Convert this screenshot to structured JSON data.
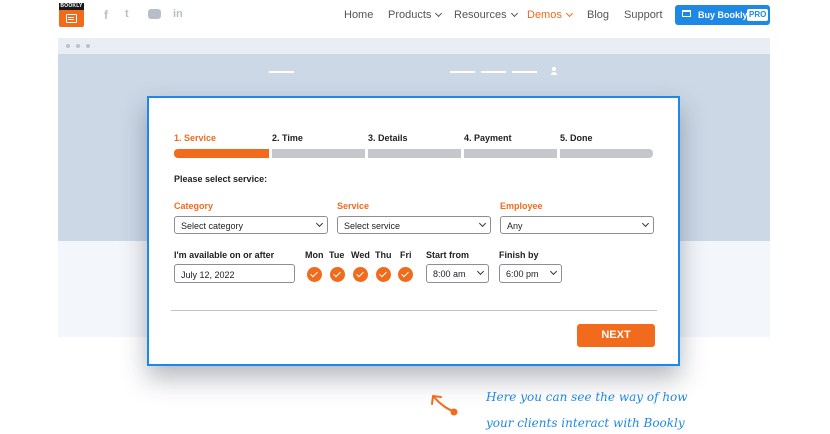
{
  "header": {
    "logo_text": "BOOKLY",
    "social_icons": [
      "facebook-icon",
      "twitter-icon",
      "youtube-icon",
      "linkedin-icon"
    ],
    "nav": [
      {
        "label": "Home",
        "dropdown": false
      },
      {
        "label": "Products",
        "dropdown": true
      },
      {
        "label": "Resources",
        "dropdown": true
      },
      {
        "label": "Demos",
        "dropdown": true,
        "active": true
      },
      {
        "label": "Blog",
        "dropdown": false
      },
      {
        "label": "Support",
        "dropdown": false
      }
    ],
    "buy_button": {
      "label": "Buy Bookly",
      "badge": "PRO"
    }
  },
  "form": {
    "steps": [
      {
        "label": "1. Service",
        "active": true
      },
      {
        "label": "2. Time",
        "active": false
      },
      {
        "label": "3. Details",
        "active": false
      },
      {
        "label": "4. Payment",
        "active": false
      },
      {
        "label": "5. Done",
        "active": false
      }
    ],
    "prompt": "Please select service:",
    "category": {
      "label": "Category",
      "value": "Select category"
    },
    "service": {
      "label": "Service",
      "value": "Select service"
    },
    "employee": {
      "label": "Employee",
      "value": "Any"
    },
    "availability": {
      "label": "I'm available on or after",
      "date": "July 12, 2022",
      "days": [
        {
          "label": "Mon",
          "checked": true
        },
        {
          "label": "Tue",
          "checked": true
        },
        {
          "label": "Wed",
          "checked": true
        },
        {
          "label": "Thu",
          "checked": true
        },
        {
          "label": "Fri",
          "checked": true
        }
      ],
      "start_label": "Start from",
      "start_value": "8:00 am",
      "finish_label": "Finish by",
      "finish_value": "6:00 pm"
    },
    "next_label": "NEXT"
  },
  "annotation": {
    "lines": [
      "Here you can see the way of how",
      "your clients interact with Bookly"
    ]
  },
  "colors": {
    "accent": "#f26b1d",
    "brand_blue": "#1e88e5",
    "mock_bg": "#ccd8e6"
  }
}
